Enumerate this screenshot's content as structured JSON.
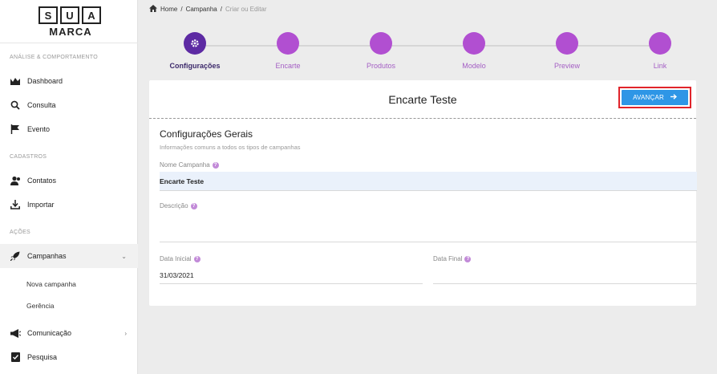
{
  "logo": {
    "letters": [
      "S",
      "U",
      "A"
    ],
    "subtitle": "MARCA"
  },
  "sidebar": {
    "section1": "ANÁLISE & COMPORTAMENTO",
    "section2": "CADASTROS",
    "section3": "AÇÕES",
    "items": [
      {
        "label": "Dashboard",
        "icon": "chart-icon"
      },
      {
        "label": "Consulta",
        "icon": "search-icon"
      },
      {
        "label": "Evento",
        "icon": "flag-icon"
      },
      {
        "label": "Contatos",
        "icon": "contacts-icon"
      },
      {
        "label": "Importar",
        "icon": "import-icon"
      },
      {
        "label": "Campanhas",
        "icon": "rocket-icon"
      },
      {
        "label": "Comunicação",
        "icon": "megaphone-icon"
      },
      {
        "label": "Pesquisa",
        "icon": "survey-icon"
      }
    ],
    "subitems": [
      "Nova campanha",
      "Gerência"
    ]
  },
  "breadcrumb": {
    "home": "Home",
    "sep": "/",
    "campanha": "Campanha",
    "current": "Criar ou Editar"
  },
  "stepper": {
    "steps": [
      "Configurações",
      "Encarte",
      "Produtos",
      "Modelo",
      "Preview",
      "Link"
    ],
    "active_index": 0
  },
  "card": {
    "title": "Encarte Teste",
    "advance_label": "AVANÇAR",
    "section_title": "Configurações Gerais",
    "section_subtitle": "Informações comuns a todos os tipos de campanhas",
    "fields": {
      "nome_label": "Nome Campanha",
      "nome_value": "Encarte Teste",
      "descricao_label": "Descrição",
      "descricao_value": "",
      "data_inicial_label": "Data Inicial",
      "data_inicial_value": "31/03/2021",
      "data_final_label": "Data Final",
      "data_final_value": ""
    }
  },
  "colors": {
    "accent": "#b14fd1",
    "active_step": "#5d2aa3",
    "button": "#2e96e6",
    "highlight": "#e0242b"
  }
}
